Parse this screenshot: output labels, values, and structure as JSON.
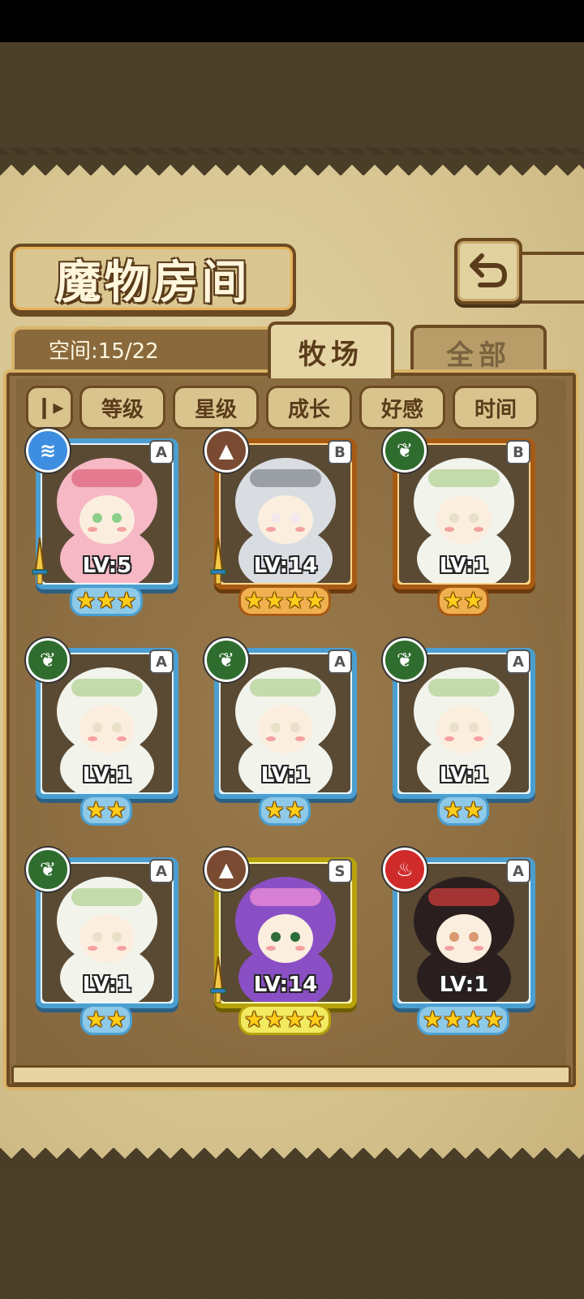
{
  "header": {
    "title": "魔物房间"
  },
  "space": {
    "label": "空间:15/22"
  },
  "tabs": [
    {
      "label": "牧场",
      "active": true
    },
    {
      "label": "全部",
      "active": false
    }
  ],
  "sort": {
    "toggle_icon": "pause-sort-icon",
    "buttons": [
      "等级",
      "星级",
      "成长",
      "好感",
      "时间"
    ]
  },
  "monsters": [
    {
      "level": "LV:5",
      "grade": "A",
      "element": "water-icon",
      "stars": 3,
      "frame": "blue",
      "equipped": true
    },
    {
      "level": "LV:14",
      "grade": "B",
      "element": "earth-icon",
      "stars": 4,
      "frame": "orange",
      "equipped": true
    },
    {
      "level": "LV:1",
      "grade": "B",
      "element": "grass-icon",
      "stars": 2,
      "frame": "orange",
      "equipped": false
    },
    {
      "level": "LV:1",
      "grade": "A",
      "element": "grass-icon",
      "stars": 2,
      "frame": "blue",
      "equipped": false
    },
    {
      "level": "LV:1",
      "grade": "A",
      "element": "grass-icon",
      "stars": 2,
      "frame": "blue",
      "equipped": false
    },
    {
      "level": "LV:1",
      "grade": "A",
      "element": "grass-icon",
      "stars": 2,
      "frame": "blue",
      "equipped": false
    },
    {
      "level": "LV:1",
      "grade": "A",
      "element": "grass-icon",
      "stars": 2,
      "frame": "blue",
      "equipped": false
    },
    {
      "level": "LV:14",
      "grade": "S",
      "element": "earth-icon",
      "stars": 4,
      "frame": "gold",
      "equipped": true
    },
    {
      "level": "LV:1",
      "grade": "A",
      "element": "fire-icon",
      "stars": 4,
      "frame": "blue",
      "equipped": false
    }
  ],
  "colors": {
    "parchment": "#d7c592",
    "panel": "#8d6e43",
    "accent": "#d9b46a",
    "star": "#ffcc1a"
  }
}
